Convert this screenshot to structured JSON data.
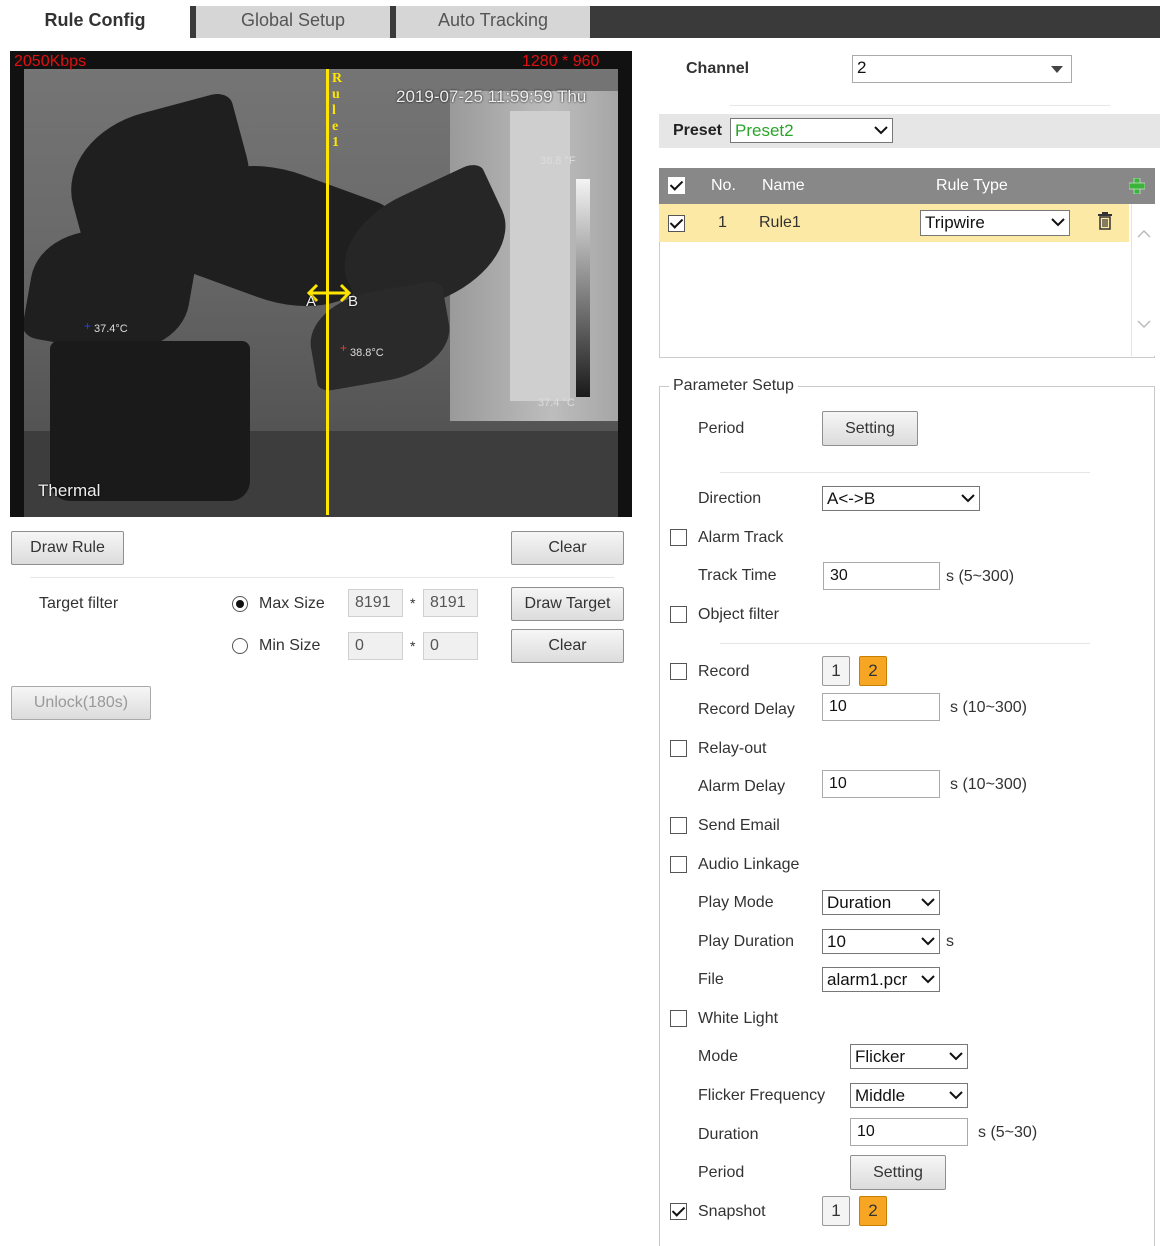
{
  "tabs": [
    "Rule Config",
    "Global Setup",
    "Auto Tracking"
  ],
  "video": {
    "bitrate": "2050Kbps",
    "resolution": "1280 * 960",
    "timestamp": "2019-07-25 11:59:59 Thu",
    "temp_high": "38.8 °F",
    "temp_low": "37.4 °C",
    "left_point_temp": "37.4°C",
    "right_point_temp": "38.8°C",
    "channel_name": "Thermal",
    "rule_label": "Rule1",
    "rule_letters": [
      "R",
      "u",
      "l",
      "e",
      "1"
    ],
    "point_a": "A",
    "point_b": "B"
  },
  "left": {
    "draw_rule": "Draw Rule",
    "clear": "Clear",
    "target_filter": "Target filter",
    "max_size": "Max Size",
    "min_size": "Min Size",
    "max_w": "8191",
    "max_h": "8191",
    "min_w": "0",
    "min_h": "0",
    "times": "*",
    "draw_target": "Draw Target",
    "clear2": "Clear",
    "unlock": "Unlock(180s)"
  },
  "channel": {
    "label": "Channel",
    "value": "2"
  },
  "preset": {
    "label": "Preset",
    "value": "Preset2"
  },
  "rules_table": {
    "headers": {
      "no": "No.",
      "name": "Name",
      "type": "Rule Type"
    },
    "rows": [
      {
        "no": "1",
        "name": "Rule1",
        "type": "Tripwire",
        "checked": true
      }
    ]
  },
  "params": {
    "legend": "Parameter Setup",
    "period": "Period",
    "setting": "Setting",
    "direction": "Direction",
    "direction_value": "A<->B",
    "alarm_track": "Alarm Track",
    "track_time": "Track Time",
    "track_time_value": "30",
    "track_time_range": "s (5~300)",
    "object_filter": "Object filter",
    "record": "Record",
    "record_ch1": "1",
    "record_ch2": "2",
    "record_delay": "Record Delay",
    "record_delay_value": "10",
    "record_delay_range": "s (10~300)",
    "relay_out": "Relay-out",
    "alarm_delay": "Alarm Delay",
    "alarm_delay_value": "10",
    "alarm_delay_range": "s (10~300)",
    "send_email": "Send Email",
    "audio_linkage": "Audio Linkage",
    "play_mode": "Play Mode",
    "play_mode_value": "Duration",
    "play_duration": "Play Duration",
    "play_duration_value": "10",
    "play_duration_unit": "s",
    "file": "File",
    "file_value": "alarm1.pcr",
    "white_light": "White Light",
    "mode": "Mode",
    "mode_value": "Flicker",
    "flicker_freq": "Flicker Frequency",
    "flicker_freq_value": "Middle",
    "duration": "Duration",
    "duration_value": "10",
    "duration_range": "s (5~30)",
    "period2": "Period",
    "setting2": "Setting",
    "snapshot": "Snapshot",
    "snap_ch1": "1",
    "snap_ch2": "2"
  }
}
